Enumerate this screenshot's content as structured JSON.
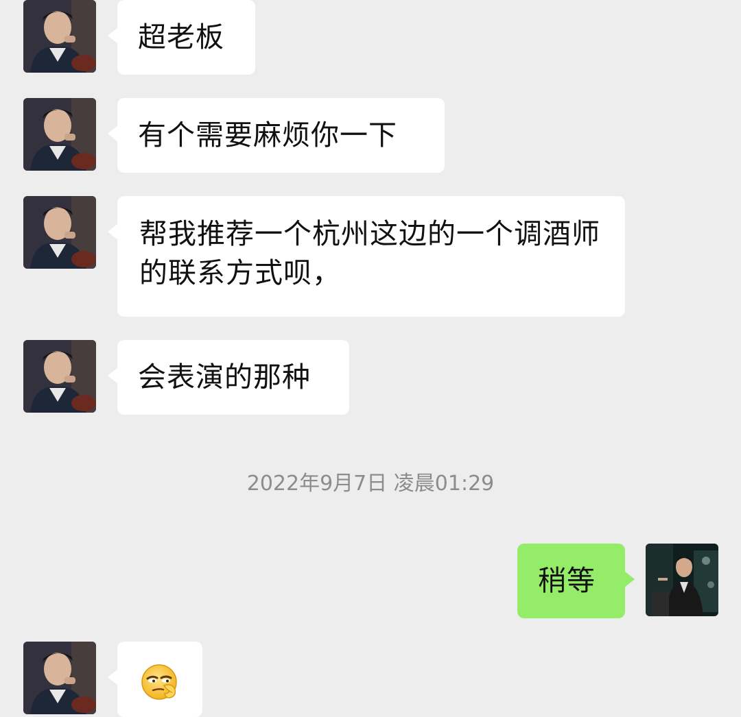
{
  "messages": [
    {
      "side": "in",
      "text": "超老板"
    },
    {
      "side": "in",
      "text": "有个需要麻烦你一下"
    },
    {
      "side": "in",
      "text": "帮我推荐一个杭州这边的一个调酒师的联系方式呗，"
    },
    {
      "side": "in",
      "text": "会表演的那种"
    },
    {
      "side": "out",
      "text": "稍等"
    },
    {
      "side": "in",
      "emoji": "smirk-emoji"
    }
  ],
  "timestamp": "2022年9月7日 凌晨01:29",
  "colors": {
    "background": "#ededed",
    "incoming_bubble": "#ffffff",
    "outgoing_bubble": "#95ec69",
    "timestamp_text": "#8c8c8c"
  }
}
